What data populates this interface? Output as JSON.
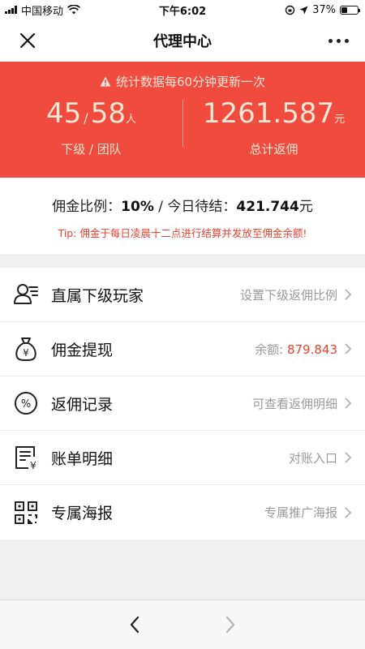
{
  "status_bar": {
    "carrier": "中国移动",
    "time": "下午6:02",
    "battery_percent": "37%",
    "battery_level": 0.37
  },
  "nav": {
    "title": "代理中心"
  },
  "stats": {
    "notice": "统计数据每60分钟更新一次",
    "subordinates": "45",
    "separator": "/",
    "team": "58",
    "people_unit": "人",
    "left_label": "下级 / 团队",
    "total_rebate": "1261.587",
    "currency_unit": "元",
    "right_label": "总计返佣"
  },
  "commission": {
    "ratio_label": "佣金比例：",
    "ratio_value": "10%",
    "pending_label": " / 今日待结：",
    "pending_value": "421.744",
    "pending_unit": "元",
    "tip": "Tip: 佣金于每日凌晨十二点进行结算并发放至佣金余额!"
  },
  "menu": [
    {
      "label": "直属下级玩家",
      "hint": "设置下级返佣比例",
      "icon": "user-list-icon"
    },
    {
      "label": "佣金提现",
      "hint": "余额: ",
      "hint_value": "879.843",
      "icon": "money-bag-icon"
    },
    {
      "label": "返佣记录",
      "hint": "可查看返佣明细",
      "icon": "percent-icon"
    },
    {
      "label": "账单明细",
      "hint": "对账入口",
      "icon": "bill-icon"
    },
    {
      "label": "专属海报",
      "hint": "专属推广海报",
      "icon": "qr-code-icon"
    }
  ],
  "colors": {
    "banner": "#f04b3e",
    "accent_red": "#e8412f",
    "banner_text": "#fde7d4"
  }
}
